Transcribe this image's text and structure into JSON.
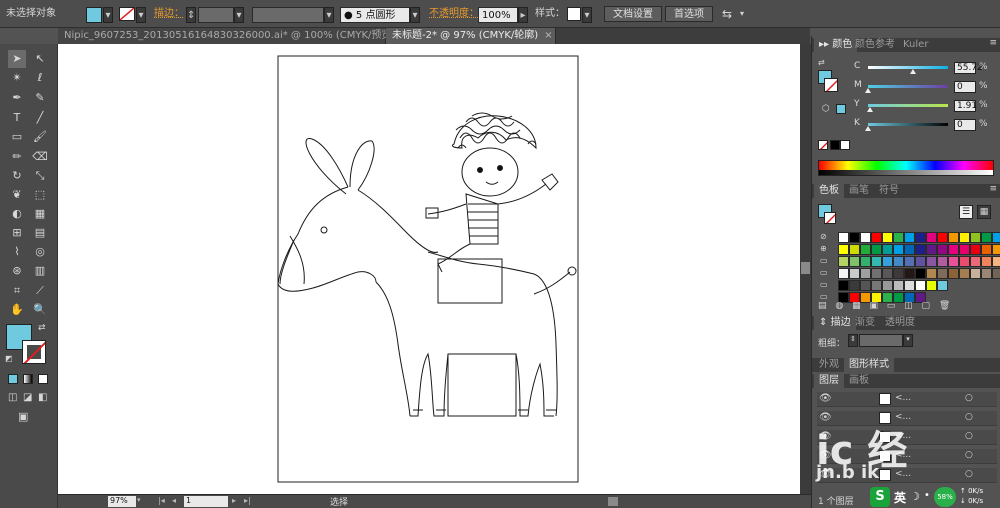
{
  "control_bar": {
    "selection_status": "未选择对象",
    "stroke_label": "描边：",
    "brush_value": "5 点圆形",
    "opacity_label": "不透明度：",
    "opacity_value": "100%",
    "style_label": "样式：",
    "doc_setup_label": "文档设置",
    "preferences_label": "首选项"
  },
  "tabs": [
    {
      "label": "Nipic_9607253_20130516164830326000.ai* @ 100% (CMYK/预览)",
      "active": false
    },
    {
      "label": "未标题-2* @ 97% (CMYK/轮廓)",
      "active": true
    }
  ],
  "color_panel": {
    "tabs": [
      "颜色",
      "颜色参考",
      "Kuler"
    ],
    "channels": [
      {
        "name": "C",
        "value": "55.72",
        "pos": 0.56,
        "gradient": "linear-gradient(90deg,#ffffff,#0fb1e6)"
      },
      {
        "name": "M",
        "value": "0",
        "pos": 0.0,
        "gradient": "linear-gradient(90deg,#4fd0e3,#6b3fa0)"
      },
      {
        "name": "Y",
        "value": "1.91",
        "pos": 0.02,
        "gradient": "linear-gradient(90deg,#6fcae0,#b9e64a)"
      },
      {
        "name": "K",
        "value": "0",
        "pos": 0.0,
        "gradient": "linear-gradient(90deg,#6fcae0,#000000)"
      }
    ]
  },
  "swatches_panel": {
    "tabs": [
      "色板",
      "画笔",
      "符号"
    ]
  },
  "stroke_panel": {
    "tabs": [
      "描边",
      "渐变",
      "透明度"
    ],
    "weight_label": "粗细："
  },
  "appearance_panel": {
    "tabs": [
      "外观",
      "图形样式"
    ]
  },
  "layers_panel": {
    "tabs": [
      "图层",
      "画板"
    ],
    "rows": [
      "<...",
      "<...",
      "<...",
      "<...",
      "<..."
    ],
    "footer": "1 个图层"
  },
  "status_bar": {
    "zoom": "97%",
    "page": "1",
    "mode": "选择"
  },
  "ime": {
    "lang": "英",
    "percent": "58%",
    "speed_up": "0K/s",
    "speed_down": "0K/s"
  },
  "colors": {
    "fill": "#6fcae0",
    "accent_orange": "#e89a2c",
    "panel_bg": "#535353"
  }
}
